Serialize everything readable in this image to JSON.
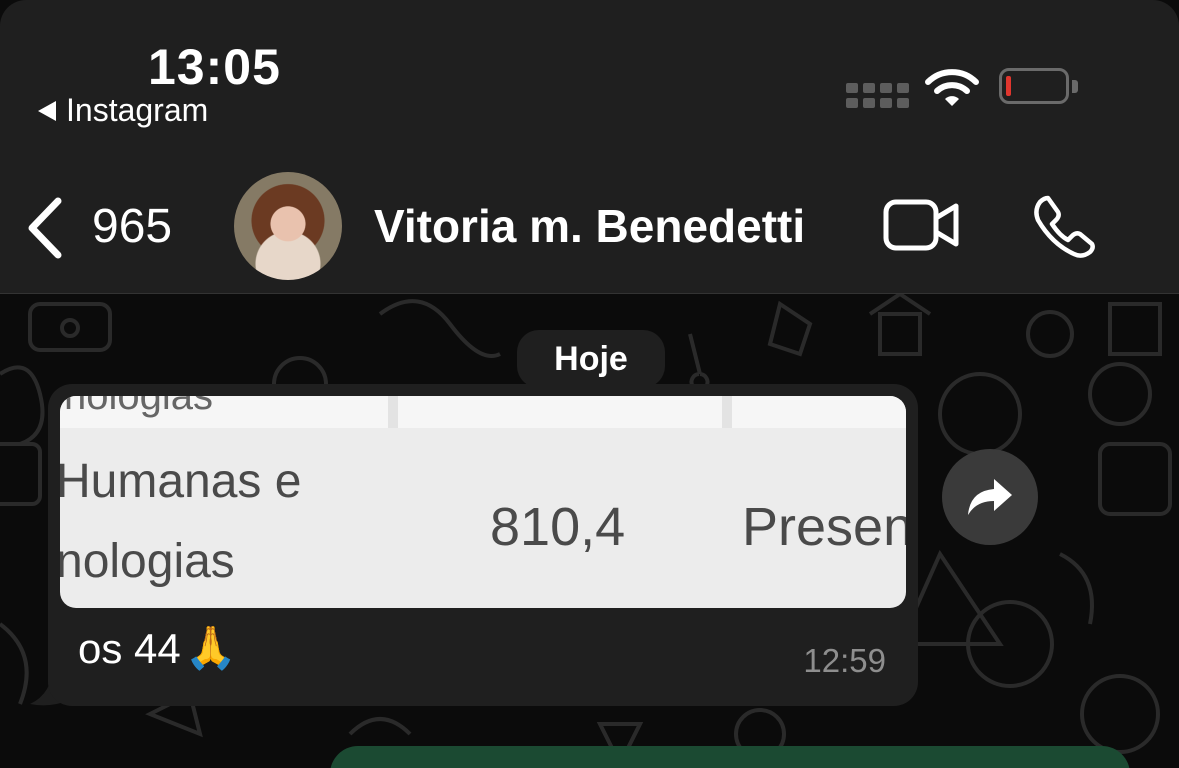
{
  "status_bar": {
    "time": "13:05",
    "back_app_label": "Instagram",
    "battery_color": "#e0362e"
  },
  "header": {
    "back_icon": "chevron-left-icon",
    "unread_count": "965",
    "contact_name": "Vitoria m. Benedetti",
    "video_icon": "video-camera-icon",
    "phone_icon": "phone-icon"
  },
  "chat": {
    "day_label": "Hoje",
    "message": {
      "image_text": {
        "cut_top": "nologias",
        "col1_line1": "Humanas e",
        "col1_line2": "nologias",
        "col2": "810,4",
        "col3": "Presen"
      },
      "caption": "os 44",
      "emoji": "🙏",
      "timestamp": "12:59"
    },
    "outgoing_bubble_color": "#1b4a32"
  }
}
